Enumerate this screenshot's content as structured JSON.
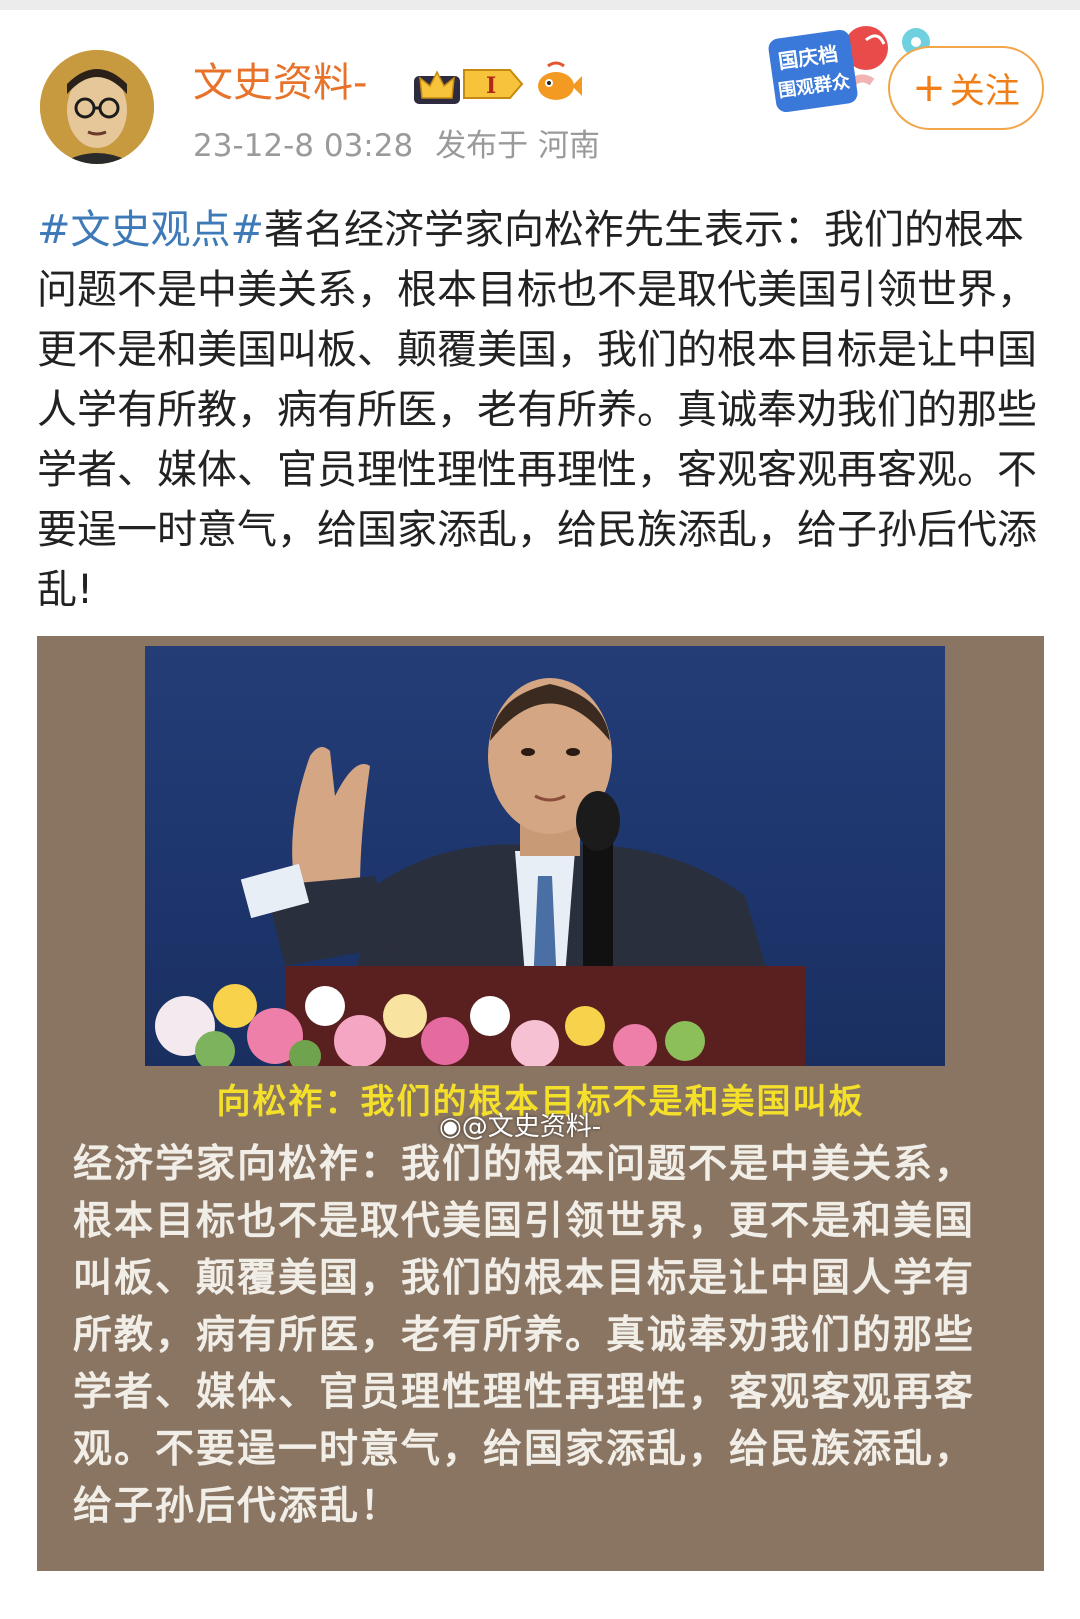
{
  "user": {
    "name": "文史资料-",
    "level_badge": "I",
    "timestamp": "23-12-8 03:28",
    "location": "发布于 河南"
  },
  "event_badge": {
    "line1": "国庆档",
    "line2": "围观群众"
  },
  "follow_button": {
    "plus": "+",
    "label": "关注"
  },
  "post": {
    "hashtag": "#文史观点#",
    "text": "著名经济学家向松祚先生表示：我们的根本问题不是中美关系，根本目标也不是取代美国引领世界，更不是和美国叫板、颠覆美国，我们的根本目标是让中国人学有所教，病有所医，老有所养。真诚奉劝我们的那些学者、媒体、官员理性理性再理性，客观客观再客观。不要逞一时意气，给国家添乱，给民族添乱，给子孙后代添乱!"
  },
  "image": {
    "title": "向松祚：我们的根本目标不是和美国叫板",
    "watermark": "@文史资料-",
    "body": "经济学家向松祚：我们的根本问题不是中美关系，根本目标也不是取代美国引领世界，更不是和美国叫板、颠覆美国，我们的根本目标是让中国人学有所教，病有所医，老有所养。真诚奉劝我们的那些学者、媒体、官员理性理性再理性，客观客观再客观。不要逞一时意气，给国家添乱，给民族添乱，给子孙后代添乱！"
  },
  "colors": {
    "username": "#e8722a",
    "hashtag": "#3e7ab8",
    "follow": "#f07f19",
    "image_title": "#f4df2a"
  },
  "icons": [
    "avatar",
    "crown-icon",
    "level-badge-icon",
    "fish-icon",
    "event-badge-icon",
    "weibo-icon"
  ]
}
